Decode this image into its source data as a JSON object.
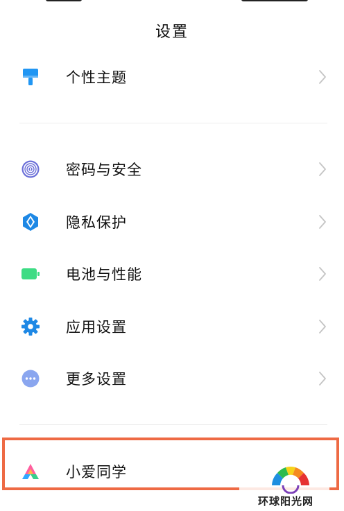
{
  "header": {
    "title": "设置"
  },
  "sections": {
    "personal": [
      {
        "label": "个性主题",
        "icon": "theme-brush-icon"
      }
    ],
    "security": [
      {
        "label": "密码与安全",
        "icon": "fingerprint-icon"
      },
      {
        "label": "隐私保护",
        "icon": "privacy-shield-icon"
      },
      {
        "label": "电池与性能",
        "icon": "battery-icon"
      },
      {
        "label": "应用设置",
        "icon": "gear-icon"
      },
      {
        "label": "更多设置",
        "icon": "more-dots-icon"
      }
    ],
    "assistant": [
      {
        "label": "小爱同学",
        "icon": "xiaoai-assistant-icon"
      }
    ]
  },
  "watermark": {
    "text": "环球阳光网"
  },
  "colors": {
    "theme_blue": "#2196f3",
    "fingerprint_purple": "#6b6fd8",
    "privacy_blue": "#1e88e5",
    "battery_green": "#3ddc84",
    "gear_blue": "#1e88e5",
    "more_blue": "#8aa6ef",
    "chevron": "#c4c4c4",
    "highlight": "#ee6a44"
  }
}
